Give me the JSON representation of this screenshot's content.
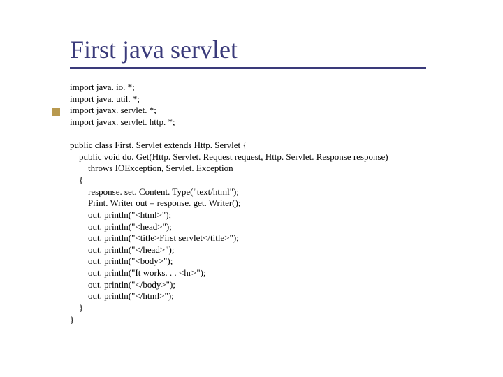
{
  "title": "First java servlet",
  "code_lines": [
    "import java. io. *;",
    "import java. util. *;",
    "import javax. servlet. *;",
    "import javax. servlet. http. *;",
    "",
    "public class First. Servlet extends Http. Servlet {",
    "    public void do. Get(Http. Servlet. Request request, Http. Servlet. Response response)",
    "        throws IOException, Servlet. Exception",
    "    {",
    "        response. set. Content. Type(\"text/html\");",
    "        Print. Writer out = response. get. Writer();",
    "        out. println(\"<html>\");",
    "        out. println(\"<head>\");",
    "        out. println(\"<title>First servlet</title>\");",
    "        out. println(\"</head>\");",
    "        out. println(\"<body>\");",
    "        out. println(\"It works. . . <hr>\");",
    "        out. println(\"</body>\");",
    "        out. println(\"</html>\");",
    "    }",
    "}"
  ]
}
